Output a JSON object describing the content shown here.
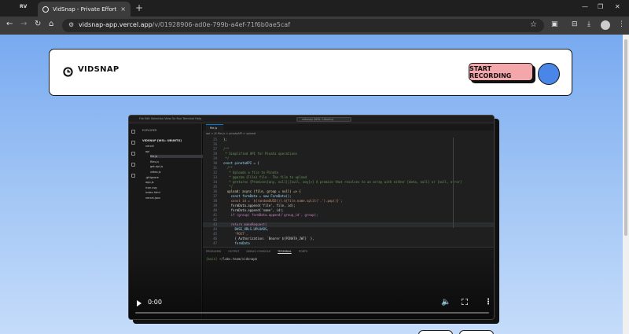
{
  "browser": {
    "profile_label": "RV",
    "tab_title": "VidSnap - Private Effortless Scr",
    "new_tab": "+",
    "tab_close": "×",
    "url_host": "vidsnap-app.vercel.app",
    "url_path": "/v/01928906-ad0e-799b-a4ef-71f6b0ae5caf",
    "icons": [
      "back-icon",
      "forward-icon",
      "reload-icon",
      "home-icon",
      "site-info-icon",
      "bookmark-star-icon",
      "extensions-icon",
      "cast-icon",
      "download-icon",
      "profile-icon",
      "menu-icon",
      "minimize-icon",
      "maximize-icon",
      "close-icon"
    ]
  },
  "header": {
    "brand": "VIDSNAP",
    "record_button": "START RECORDING",
    "record_button_color": "#f3a7ab",
    "avatar_color": "#4a86e8"
  },
  "video": {
    "time": "0:00",
    "editor": {
      "menu": "File  Edit  Selection  View  Go  Run  Terminal  Help",
      "search": "vidsnap (WSL: Ubuntu)",
      "sidebar_header": "EXPLORER",
      "sidebar_root": "VIDSNAP [WSL: UBUNTU]",
      "files": [
        {
          "name": "vercel",
          "indent": 1
        },
        {
          "name": "api",
          "indent": 1
        },
        {
          "name": "file.js",
          "indent": 2,
          "selected": true
        },
        {
          "name": "files.js",
          "indent": 2
        },
        {
          "name": "get-api.js",
          "indent": 2
        },
        {
          "name": "video.js",
          "indent": 2
        },
        {
          "name": ".gitignore",
          "indent": 1
        },
        {
          "name": "app.js",
          "indent": 1
        },
        {
          "name": "icon.svg",
          "indent": 1
        },
        {
          "name": "index.html",
          "indent": 1
        },
        {
          "name": "vercel.json",
          "indent": 1
        }
      ],
      "tab": "file.js",
      "breadcrumb": "api > JS file.js > pinataAPI > upload",
      "code": [
        {
          "n": "25",
          "t": "};",
          "c": "pl"
        },
        {
          "n": "26",
          "t": "",
          "c": "pl"
        },
        {
          "n": "27",
          "t": "/**",
          "c": "cm"
        },
        {
          "n": "28",
          "t": " * Simplified API for Pinata operations",
          "c": "cm"
        },
        {
          "n": "29",
          "t": " */",
          "c": "cm"
        },
        {
          "n": "30",
          "t": "const pinataAPI = {",
          "c": "vr"
        },
        {
          "n": "31",
          "t": "  /**",
          "c": "cm"
        },
        {
          "n": "32",
          "t": "   * Uploads a file to Pinata",
          "c": "cm"
        },
        {
          "n": "33",
          "t": "   * @param {File} file - The file to upload",
          "c": "cm"
        },
        {
          "n": "34",
          "t": "   * @returns {Promise<[any, null]|[null, any]>} A promise that resolves to an array with either [data, null] or [null, error]",
          "c": "cm"
        },
        {
          "n": "35",
          "t": "   */",
          "c": "cm"
        },
        {
          "n": "36",
          "t": "  upload: async (file, group = null) => {",
          "c": "fn"
        },
        {
          "n": "37",
          "t": "    const formData = new FormData();",
          "c": "vr"
        },
        {
          "n": "38",
          "t": "    const id = `${randomUUID()}.${file.name.split('.').pop()}`;",
          "c": "st"
        },
        {
          "n": "39",
          "t": "    formData.append('file', file, id);",
          "c": "pl"
        },
        {
          "n": "40",
          "t": "    formData.append('name', id);",
          "c": "pl"
        },
        {
          "n": "41",
          "t": "    if (group) formData.append('group_id', group);",
          "c": "kw"
        },
        {
          "n": "42",
          "t": "",
          "c": "pl"
        },
        {
          "n": "43",
          "t": "    return makeRequest(",
          "c": "kw"
        },
        {
          "n": "44",
          "t": "      BASE_URLS.UPLOADS,",
          "c": "vr"
        },
        {
          "n": "45",
          "t": "      'POST',",
          "c": "st"
        },
        {
          "n": "46",
          "t": "      { Authorization: `Bearer ${PINATA_JWT}` },",
          "c": "pl"
        },
        {
          "n": "47",
          "t": "      formData",
          "c": "vr"
        }
      ],
      "panel_tabs": [
        "PROBLEMS",
        "OUTPUT",
        "DEBUG CONSOLE",
        "TERMINAL",
        "PORTS"
      ],
      "terminal_prompt": "[main]",
      "terminal_path": "~/labs.team/vidsnap$"
    }
  }
}
